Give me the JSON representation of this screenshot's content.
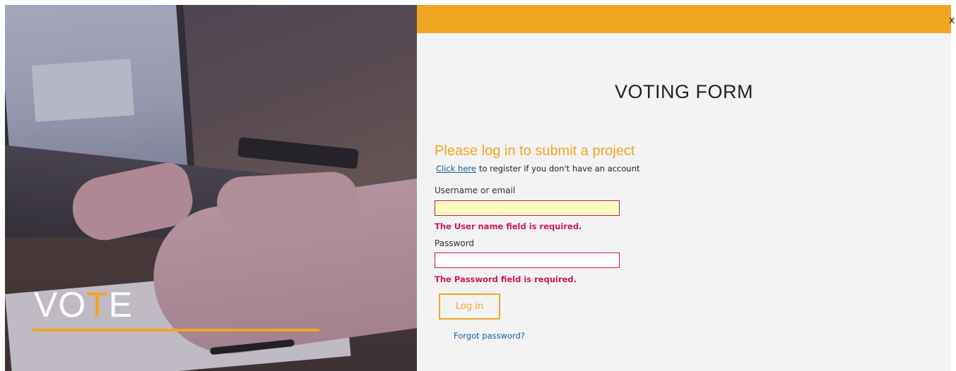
{
  "hero": {
    "title_before": "VO",
    "title_accent": "T",
    "title_after": "E",
    "accent_color": "#f0a623"
  },
  "header": {
    "bar_color": "#f0a623",
    "close_label": "x"
  },
  "form": {
    "title": "VOTING FORM",
    "heading": "Please log in to submit a project",
    "register_link": "Click here",
    "register_text": "to register if you don't have an account",
    "username_label": "Username or email",
    "username_value": "",
    "username_error": "The User name field is required.",
    "password_label": "Password",
    "password_value": "",
    "password_error": "The Password field is required.",
    "login_button": "Log in",
    "forgot_link": "Forgot password?",
    "error_color": "#d0155a"
  }
}
